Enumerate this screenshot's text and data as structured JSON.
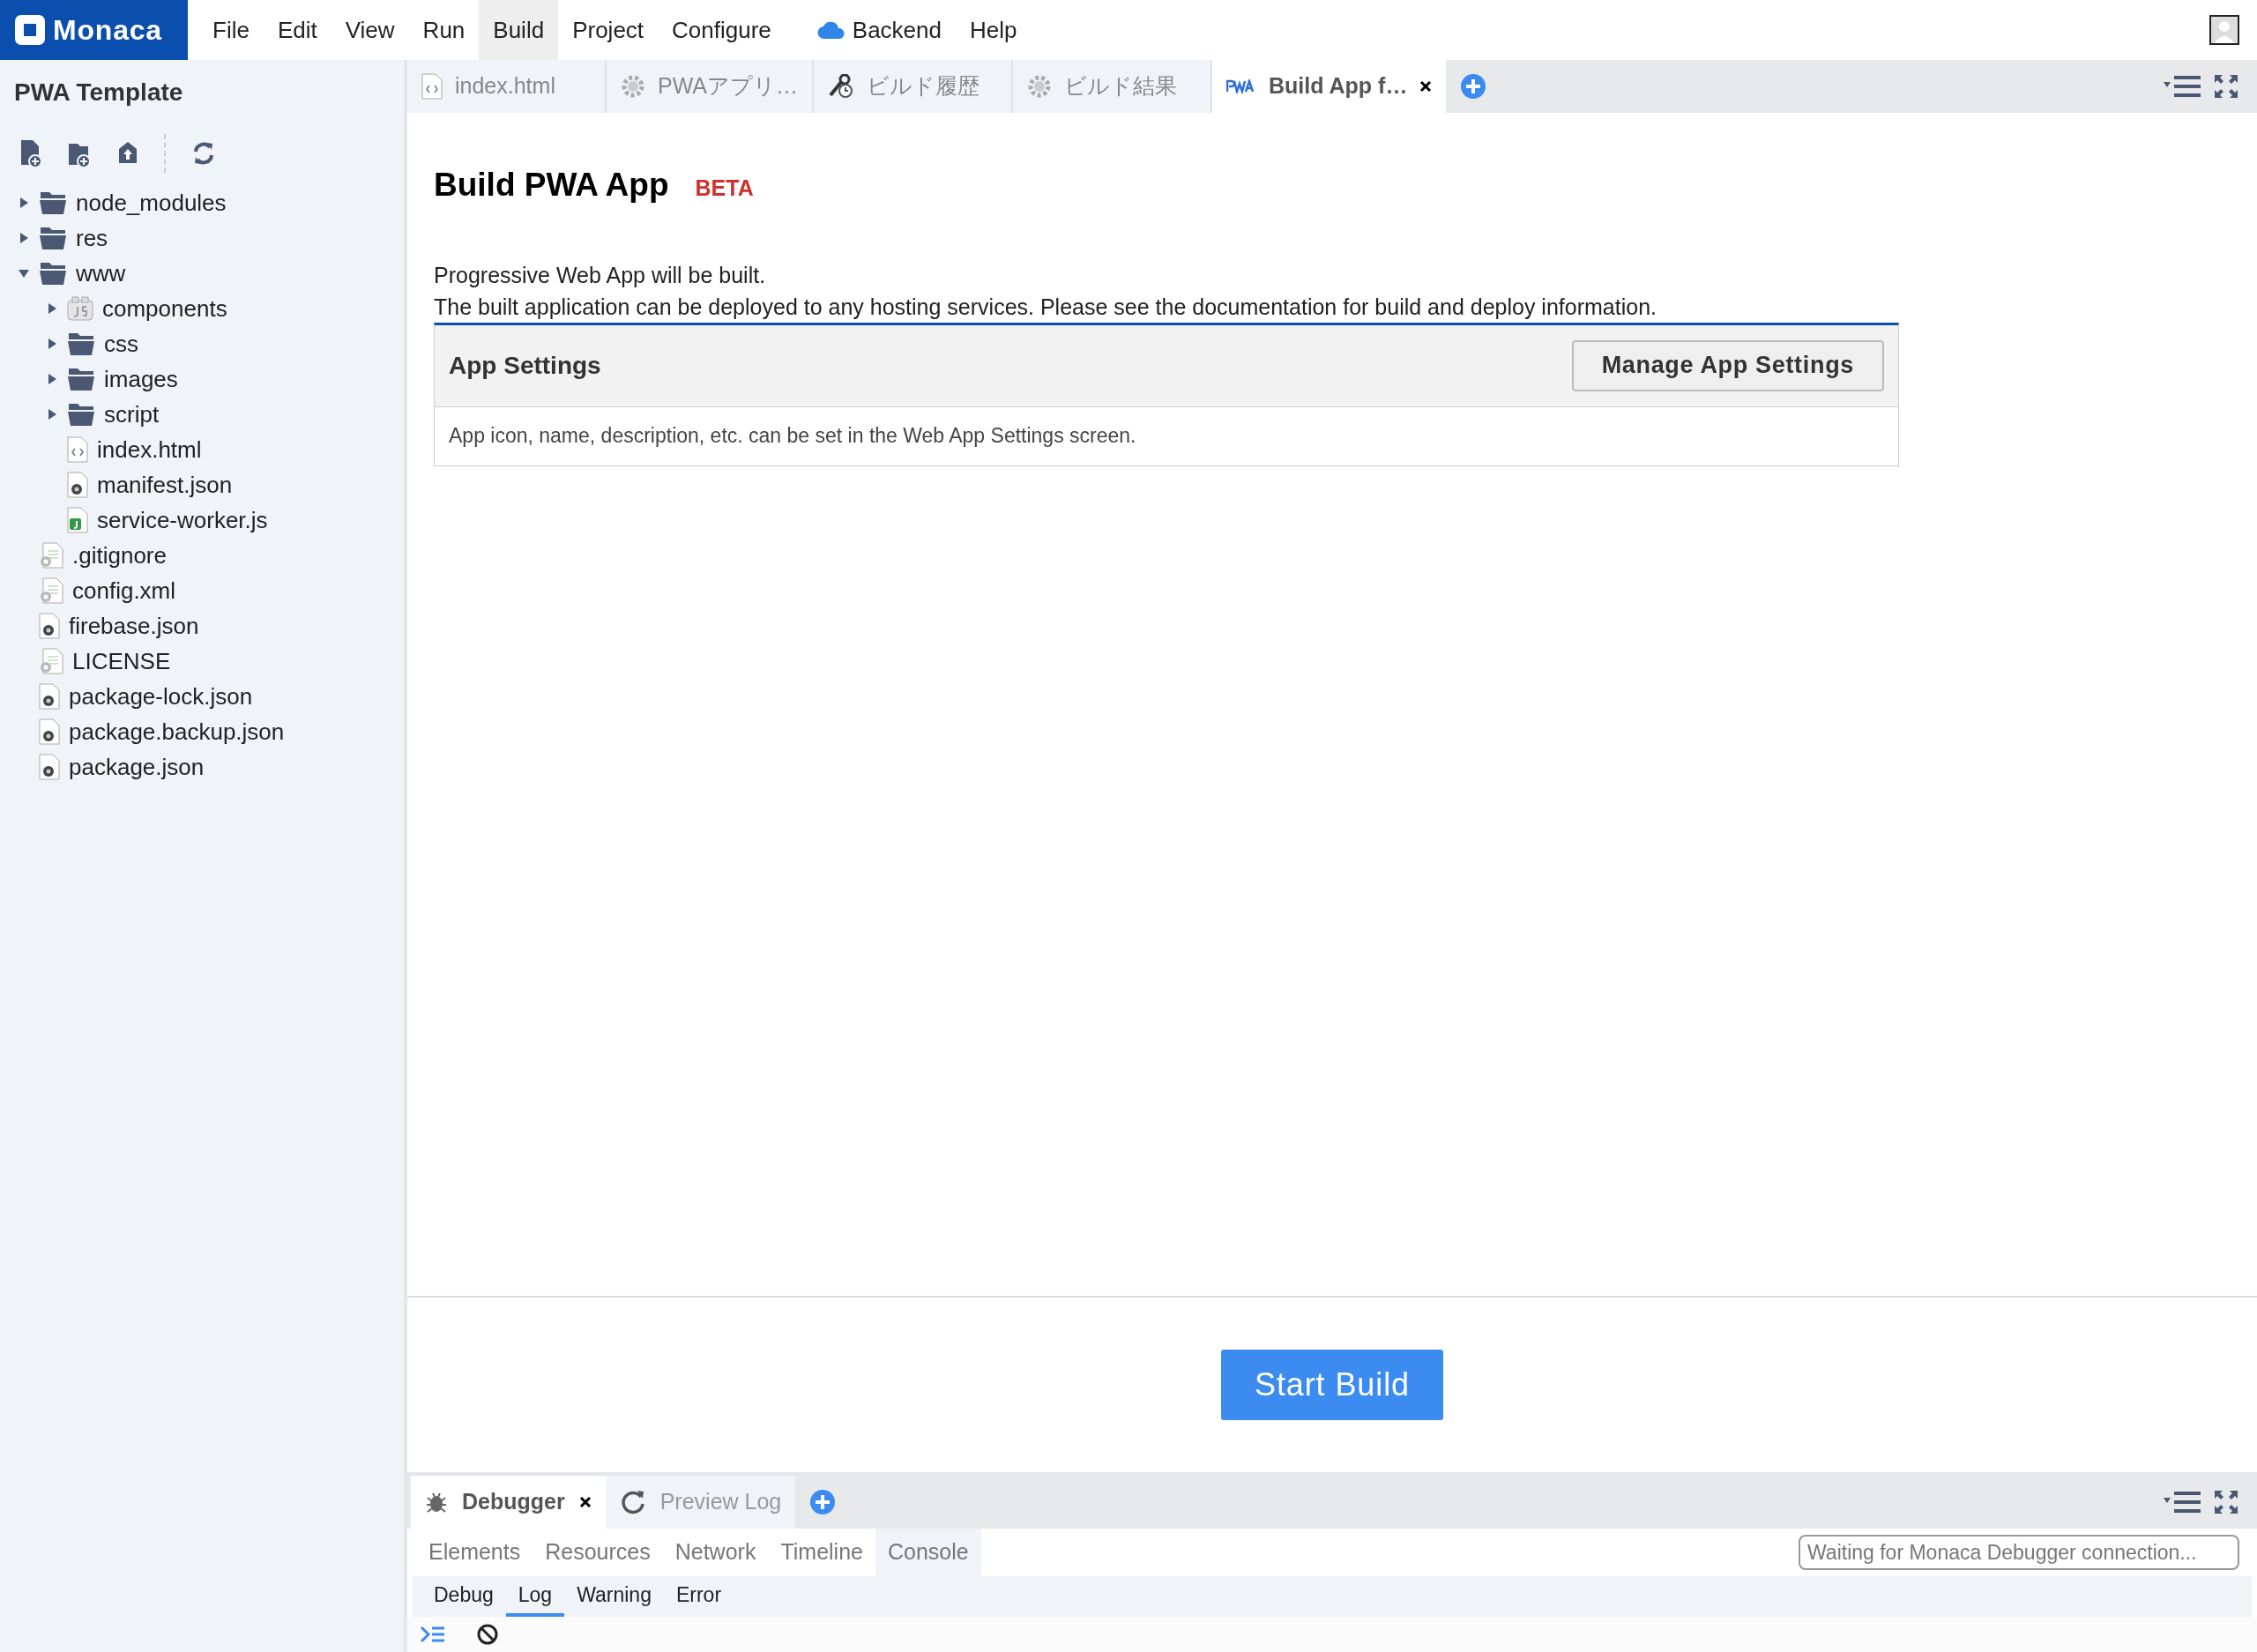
{
  "menu_bar": {
    "logo": "Monaca",
    "items": [
      {
        "label": "File",
        "kind": "plain",
        "selected": false
      },
      {
        "label": "Edit",
        "kind": "plain",
        "selected": false
      },
      {
        "label": "View",
        "kind": "plain",
        "selected": false
      },
      {
        "label": "Run",
        "kind": "plain",
        "selected": false
      },
      {
        "label": "Build",
        "kind": "plain",
        "selected": true
      },
      {
        "label": "Project",
        "kind": "plain",
        "selected": false
      },
      {
        "label": "Configure",
        "kind": "plain",
        "selected": false
      },
      {
        "label": "Backend",
        "kind": "cloud",
        "selected": false
      },
      {
        "label": "Help",
        "kind": "plain",
        "selected": false
      }
    ]
  },
  "sidebar": {
    "title": "PWA Template",
    "tree": [
      {
        "name": "node_modules",
        "kind": "folder",
        "expanded": false
      },
      {
        "name": "res",
        "kind": "folder",
        "expanded": false
      },
      {
        "name": "www",
        "kind": "folder",
        "expanded": true,
        "children": [
          {
            "name": "components",
            "kind": "js-folder",
            "expanded": false
          },
          {
            "name": "css",
            "kind": "folder",
            "expanded": false
          },
          {
            "name": "images",
            "kind": "folder",
            "expanded": false
          },
          {
            "name": "script",
            "kind": "folder",
            "expanded": false
          },
          {
            "name": "index.html",
            "kind": "html"
          },
          {
            "name": "manifest.json",
            "kind": "json"
          },
          {
            "name": "service-worker.js",
            "kind": "js"
          }
        ]
      },
      {
        "name": ".gitignore",
        "kind": "config"
      },
      {
        "name": "config.xml",
        "kind": "config"
      },
      {
        "name": "firebase.json",
        "kind": "json"
      },
      {
        "name": "LICENSE",
        "kind": "config"
      },
      {
        "name": "package-lock.json",
        "kind": "json"
      },
      {
        "name": "package.backup.json",
        "kind": "json"
      },
      {
        "name": "package.json",
        "kind": "json"
      }
    ]
  },
  "editor_tabs": [
    {
      "label": "index.html",
      "kind": "html",
      "selected": false
    },
    {
      "label": "PWAアプリ…",
      "kind": "gear",
      "selected": false
    },
    {
      "label": "ビルド履歴",
      "kind": "history",
      "selected": false
    },
    {
      "label": "ビルド結果",
      "kind": "gear",
      "selected": false
    },
    {
      "label": "Build App f…",
      "kind": "pwa",
      "selected": true
    }
  ],
  "page": {
    "title": "Build PWA App",
    "badge": "BETA",
    "paragraphs": [
      "Progressive Web App will be built.",
      "The built application can be deployed to any hosting services. Please see the documentation for build and deploy information."
    ],
    "card": {
      "title": "App Settings",
      "button": "Manage App Settings",
      "body": "App icon, name, description, etc. can be set in the Web App Settings screen."
    },
    "start_button": "Start Build"
  },
  "debug_panel": {
    "tabs": [
      {
        "label": "Debugger",
        "kind": "bug",
        "selected": true
      },
      {
        "label": "Preview Log",
        "kind": "reload",
        "selected": false
      }
    ],
    "sections": [
      {
        "label": "Elements",
        "selected": false
      },
      {
        "label": "Resources",
        "selected": false
      },
      {
        "label": "Network",
        "selected": false
      },
      {
        "label": "Timeline",
        "selected": false
      },
      {
        "label": "Console",
        "selected": true
      }
    ],
    "status": "Waiting for Monaca Debugger connection...",
    "levels": [
      {
        "label": "Debug",
        "selected": false
      },
      {
        "label": "Log",
        "selected": true
      },
      {
        "label": "Warning",
        "selected": false
      },
      {
        "label": "Error",
        "selected": false
      }
    ]
  }
}
